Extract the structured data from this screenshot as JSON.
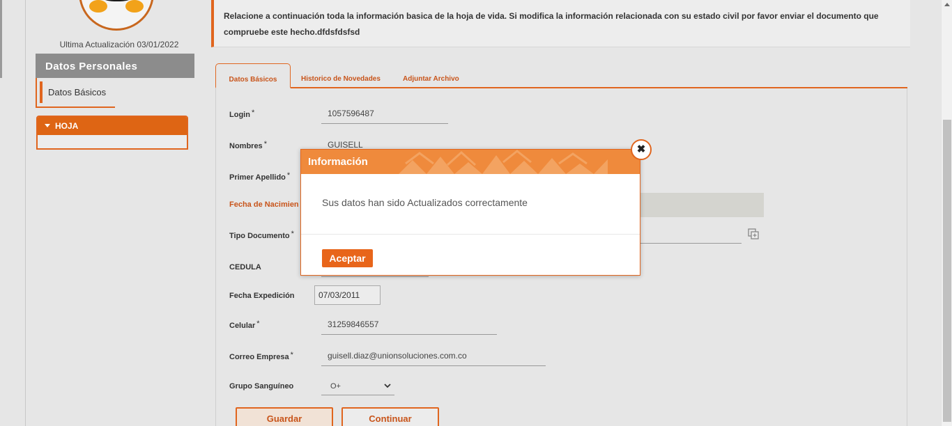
{
  "profile": {
    "last_update": "Ultima Actualización 03/01/2022"
  },
  "sidebar": {
    "header": "Datos Personales",
    "items": [
      {
        "label": "Datos Básicos"
      }
    ],
    "hoja": {
      "label": "HOJA"
    }
  },
  "banner": {
    "text": "Relacione a continuación toda la información basica de la hoja de vida. Si modifica la información relacionada con su estado civil por favor enviar el documento que compruebe este hecho.dfdsfdsfsd"
  },
  "tabs": [
    {
      "label": "Datos Básicos",
      "active": true
    },
    {
      "label": "Historico de Novedades",
      "active": false
    },
    {
      "label": "Adjuntar Archivo",
      "active": false
    }
  ],
  "form": {
    "required_mark": "*",
    "login": {
      "label": "Login",
      "value": "1057596487"
    },
    "nombres": {
      "label": "Nombres",
      "value": "GUISELL"
    },
    "primer_apellido": {
      "label": "Primer Apellido"
    },
    "fecha_nacimiento": {
      "label": "Fecha de Nacimien"
    },
    "tipo_documento": {
      "label": "Tipo Documento"
    },
    "cedula": {
      "label": "CEDULA"
    },
    "fecha_expedicion": {
      "label": "Fecha Expedición",
      "value": "07/03/2011"
    },
    "celular": {
      "label": "Celular",
      "value": "31259846557"
    },
    "correo": {
      "label": "Correo Empresa",
      "value": "guisell.diaz@unionsoluciones.com.co"
    },
    "grupo_sanguineo": {
      "label": "Grupo Sanguíneo",
      "value": "O+"
    }
  },
  "buttons": {
    "guardar": "Guardar",
    "continuar": "Continuar"
  },
  "modal": {
    "title": "Información",
    "message": "Sus datos han sido Actualizados correctamente",
    "accept": "Aceptar",
    "close_glyph": "✖"
  },
  "colors": {
    "accent": "#e0651e",
    "modal_header": "#ef8a3c"
  }
}
